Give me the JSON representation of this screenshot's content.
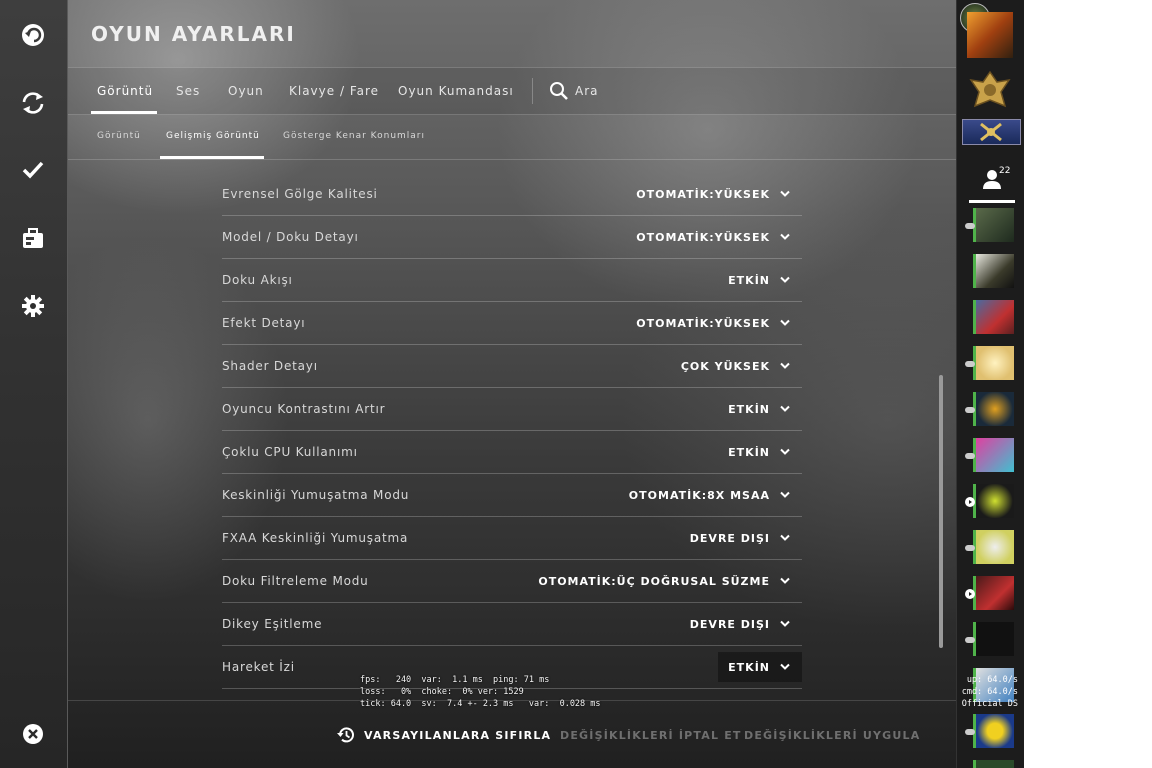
{
  "window": {
    "title": "OYUN AYARLARI"
  },
  "tabs": [
    {
      "label": "Görüntü",
      "active": true
    },
    {
      "label": "Ses",
      "active": false
    },
    {
      "label": "Oyun",
      "active": false
    },
    {
      "label": "Klavye / Fare",
      "active": false
    },
    {
      "label": "Oyun Kumandası",
      "active": false
    }
  ],
  "search": {
    "label": "Ara",
    "icon": "search-icon"
  },
  "subtabs": [
    {
      "label": "Görüntü",
      "active": false
    },
    {
      "label": "Gelişmiş Görüntü",
      "active": true
    },
    {
      "label": "Gösterge Kenar Konumları",
      "active": false
    }
  ],
  "settings": [
    {
      "label": "Evrensel Gölge Kalitesi",
      "value": "OTOMATİK:YÜKSEK"
    },
    {
      "label": "Model / Doku Detayı",
      "value": "OTOMATİK:YÜKSEK"
    },
    {
      "label": "Doku Akışı",
      "value": "ETKİN"
    },
    {
      "label": "Efekt Detayı",
      "value": "OTOMATİK:YÜKSEK"
    },
    {
      "label": "Shader Detayı",
      "value": "ÇOK YÜKSEK"
    },
    {
      "label": "Oyuncu Kontrastını Artır",
      "value": "ETKİN"
    },
    {
      "label": "Çoklu CPU Kullanımı",
      "value": "ETKİN"
    },
    {
      "label": "Keskinliği Yumuşatma Modu",
      "value": "OTOMATİK:8X MSAA"
    },
    {
      "label": "FXAA Keskinliği Yumuşatma",
      "value": "DEVRE DIŞI"
    },
    {
      "label": "Doku Filtreleme Modu",
      "value": "OTOMATİK:ÜÇ DOĞRUSAL SÜZME"
    },
    {
      "label": "Dikey Eşitleme",
      "value": "DEVRE DIŞI"
    },
    {
      "label": "Hareket İzi",
      "value": "ETKİN"
    }
  ],
  "netgraph": {
    "line1": "fps:   240  var:  1.1 ms  ping: 71 ms",
    "line2": "loss:   0%  choke:  0% ver: 1529",
    "line3": "tick: 64.0  sv:  7.4 +- 2.3 ms   var:  0.028 ms"
  },
  "footer": {
    "reset_label": "VARSAYILANLARA SIFIRLA",
    "cancel_label": "DEĞİŞİKLİKLERİ İPTAL ET",
    "apply_label": "DEĞİŞİKLİKLERİ UYGULA"
  },
  "sidebar": {
    "friends_count": "22",
    "overlay_line1": "up: 64.0/s",
    "overlay_line2": "cmd: 64.0/s",
    "overlay_line3": "Official DS"
  },
  "left_nav": [
    "back-icon",
    "refresh-icon",
    "checkmark-icon",
    "briefcase-icon",
    "gear-icon",
    "close-icon"
  ],
  "colors": {
    "accent": "#ffffff",
    "friend_online": "#4fb34a",
    "disabled_text": "#6f6f6f"
  }
}
